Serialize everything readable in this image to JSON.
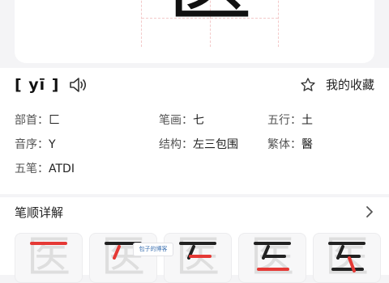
{
  "character": "医",
  "pinyin": "[ yī ]",
  "favorite": {
    "label": "我的收藏"
  },
  "details": {
    "radical": {
      "key": "部首：",
      "value": "匚"
    },
    "strokes": {
      "key": "笔画：",
      "value": "七"
    },
    "five_elements": {
      "key": "五行：",
      "value": "土"
    },
    "phonetic_order": {
      "key": "音序：",
      "value": "Y"
    },
    "structure": {
      "key": "结构：",
      "value": "左三包围"
    },
    "traditional": {
      "key": "繁体：",
      "value": "醫"
    },
    "wubi": {
      "key": "五笔：",
      "value": "ATDI"
    }
  },
  "stroke_order": {
    "title": "笔顺详解",
    "cards": [
      "医",
      "医",
      "医",
      "医",
      "医"
    ]
  },
  "watermark": "包子的博客",
  "colors": {
    "accent": "#e53935",
    "ghost": "#dedede"
  }
}
